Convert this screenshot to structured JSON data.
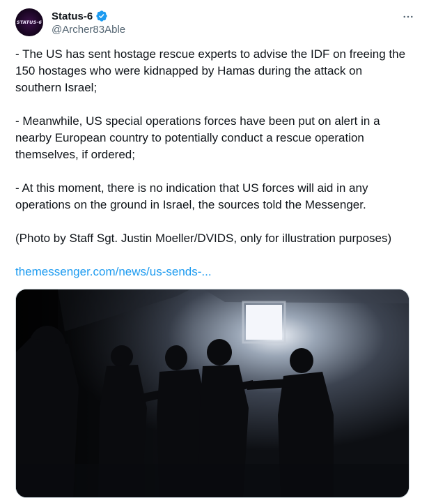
{
  "author": {
    "display_name": "Status-6",
    "handle": "@Archer83Able",
    "avatar_text": "STATUS-6"
  },
  "icons": {
    "verified": "verified-badge-icon",
    "more": "more-options-icon"
  },
  "tweet": {
    "paragraphs": [
      "- The US has sent hostage rescue experts to advise the IDF on freeing the 150 hostages who were kidnapped by Hamas during the attack on southern Israel;",
      "- Meanwhile, US special operations forces have been put on alert in a nearby European country to potentially conduct a rescue operation themselves, if ordered;",
      "- At this moment, there is no indication that US forces will aid in any operations on the ground in Israel, the sources told the Messenger.",
      "(Photo by Staff Sgt. Justin Moeller/DVIDS, only for illustration purposes)"
    ],
    "link_text": "themessenger.com/news/us-sends-..."
  },
  "colors": {
    "accent": "#1d9bf0",
    "text": "#0f1419",
    "secondary": "#536471"
  }
}
